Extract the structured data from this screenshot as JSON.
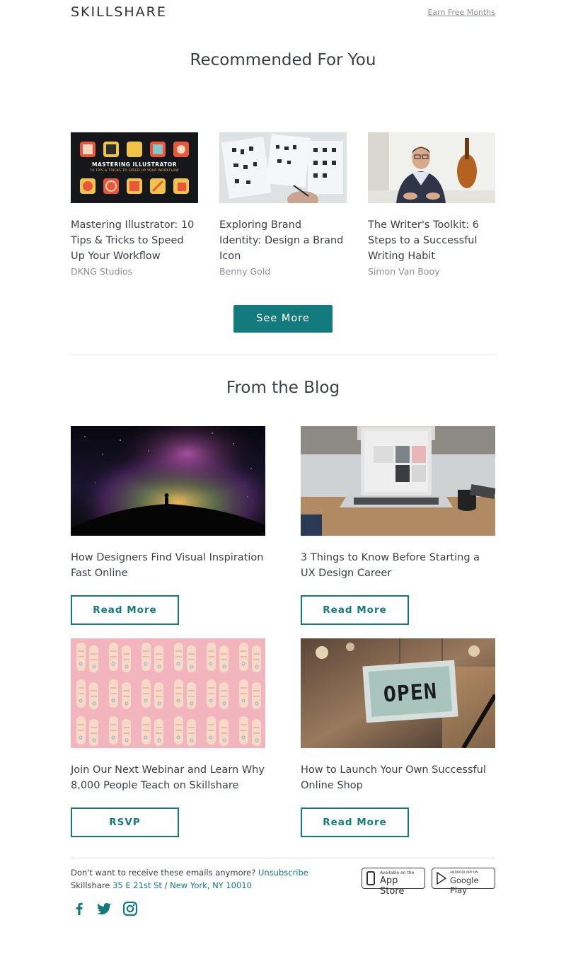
{
  "header": {
    "logo": "SKILLSHARE",
    "earn_link": "Earn Free Months"
  },
  "recommended": {
    "title": "Recommended For You",
    "courses": [
      {
        "title": "Mastering Illustrator: 10 Tips & Tricks to Speed Up Your Workflow",
        "author": "DKNG Studios",
        "thumb_heading": "MASTERING ILLUSTRATOR",
        "thumb_sub": "10 TIPS & TRICKS TO SPEED UP YOUR WORKFLOW"
      },
      {
        "title": "Exploring Brand Identity: Design a Brand Icon",
        "author": "Benny Gold"
      },
      {
        "title": "The Writer's Toolkit: 6 Steps to a Successful Writing Habit",
        "author": "Simon Van Booy"
      }
    ],
    "see_more": "See More"
  },
  "blog": {
    "title": "From the Blog",
    "posts": [
      {
        "title": "How Designers Find Visual Inspiration Fast Online",
        "button": "Read More"
      },
      {
        "title": "3 Things to Know Before Starting a UX Design Career",
        "button": "Read More"
      },
      {
        "title": "Join Our Next Webinar and Learn Why 8,000 People Teach on Skillshare",
        "button": "RSVP"
      },
      {
        "title": "How to Launch Your Own Successful Online Shop",
        "button": "Read More",
        "sign_text": "OPEN"
      }
    ]
  },
  "footer": {
    "unsub_prefix": "Don't want to receive these emails anymore?",
    "unsub_link": "Unsubscribe",
    "company": "Skillshare",
    "address_street": "35 E 21st St",
    "address_sep": "/",
    "address_city": "New York, NY 10010",
    "app_store_small": "Available on the",
    "app_store_big": "App Store",
    "play_small": "ANDROID APP ON",
    "play_big": "Google Play",
    "social_icons": [
      "facebook-icon",
      "twitter-icon",
      "instagram-icon"
    ]
  },
  "colors": {
    "accent": "#137a7e",
    "text": "#3b3f45",
    "muted": "#8b8f96"
  }
}
